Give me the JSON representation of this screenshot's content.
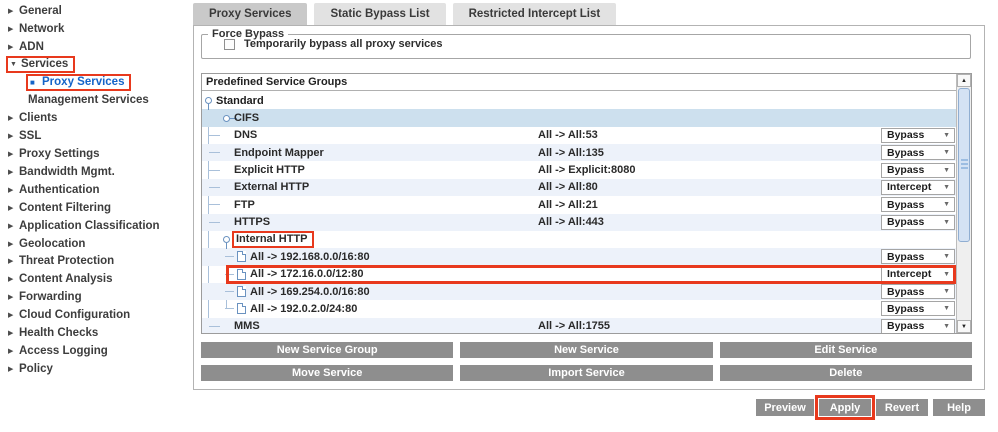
{
  "sidebar": {
    "items": [
      {
        "label": "General",
        "arrow": "right"
      },
      {
        "label": "Network",
        "arrow": "right"
      },
      {
        "label": "ADN",
        "arrow": "right"
      },
      {
        "label": "Services",
        "arrow": "down",
        "highlighted": true
      },
      {
        "label": "Proxy Services",
        "indent": true,
        "bullet": true,
        "selected": true,
        "highlighted": true
      },
      {
        "label": "Management Services",
        "indent": true
      },
      {
        "label": "Clients",
        "arrow": "right"
      },
      {
        "label": "SSL",
        "arrow": "right"
      },
      {
        "label": "Proxy Settings",
        "arrow": "right"
      },
      {
        "label": "Bandwidth Mgmt.",
        "arrow": "right"
      },
      {
        "label": "Authentication",
        "arrow": "right"
      },
      {
        "label": "Content Filtering",
        "arrow": "right"
      },
      {
        "label": "Application Classification",
        "arrow": "right"
      },
      {
        "label": "Geolocation",
        "arrow": "right"
      },
      {
        "label": "Threat Protection",
        "arrow": "right"
      },
      {
        "label": "Content Analysis",
        "arrow": "right"
      },
      {
        "label": "Forwarding",
        "arrow": "right"
      },
      {
        "label": "Cloud Configuration",
        "arrow": "right"
      },
      {
        "label": "Health Checks",
        "arrow": "right"
      },
      {
        "label": "Access Logging",
        "arrow": "right"
      },
      {
        "label": "Policy",
        "arrow": "right"
      }
    ]
  },
  "tabs": [
    {
      "label": "Proxy Services",
      "active": true
    },
    {
      "label": "Static Bypass List",
      "active": false
    },
    {
      "label": "Restricted Intercept List",
      "active": false
    }
  ],
  "force_bypass": {
    "legend": "Force Bypass",
    "checkbox_label": "Temporarily bypass all proxy services",
    "checked": false
  },
  "table": {
    "header": "Predefined Service Groups",
    "rows": [
      {
        "type": "group-open",
        "level": 0,
        "label": "Standard"
      },
      {
        "type": "group-closed",
        "level": 1,
        "label": "CIFS",
        "selected": true
      },
      {
        "type": "service",
        "level": 1,
        "label": "DNS",
        "destination": "All -> All:53",
        "action": "Bypass"
      },
      {
        "type": "service",
        "level": 1,
        "label": "Endpoint Mapper",
        "destination": "All -> All:135",
        "action": "Bypass",
        "shade": true
      },
      {
        "type": "service",
        "level": 1,
        "label": "Explicit HTTP",
        "destination": "All -> Explicit:8080",
        "action": "Bypass"
      },
      {
        "type": "service",
        "level": 1,
        "label": "External HTTP",
        "destination": "All -> All:80",
        "action": "Intercept",
        "shade": true
      },
      {
        "type": "service",
        "level": 1,
        "label": "FTP",
        "destination": "All -> All:21",
        "action": "Bypass"
      },
      {
        "type": "service",
        "level": 1,
        "label": "HTTPS",
        "destination": "All -> All:443",
        "action": "Bypass",
        "shade": true
      },
      {
        "type": "group-open",
        "level": 1,
        "label": "Internal HTTP",
        "highlight": "label"
      },
      {
        "type": "rule",
        "level": 2,
        "label": "All -> 192.168.0.0/16:80",
        "action": "Bypass",
        "shade": true
      },
      {
        "type": "rule",
        "level": 2,
        "label": "All -> 172.16.0.0/12:80",
        "action": "Intercept",
        "highlight": "row"
      },
      {
        "type": "rule",
        "level": 2,
        "label": "All -> 169.254.0.0/16:80",
        "action": "Bypass",
        "shade": true
      },
      {
        "type": "rule",
        "level": 2,
        "label": "All -> 192.0.2.0/24:80",
        "action": "Bypass"
      },
      {
        "type": "service",
        "level": 1,
        "label": "MMS",
        "destination": "All -> All:1755",
        "action": "Bypass",
        "shade": true
      }
    ]
  },
  "action_buttons": {
    "rows": [
      [
        "New Service Group",
        "New Service",
        "Edit Service"
      ],
      [
        "Move Service",
        "Import Service",
        "Delete"
      ]
    ]
  },
  "footer_buttons": [
    {
      "label": "Preview"
    },
    {
      "label": "Apply",
      "highlighted": true
    },
    {
      "label": "Revert"
    },
    {
      "label": "Help"
    }
  ],
  "icons": {
    "chevron_right": "▶",
    "chevron_down": "▼",
    "dropdown_arrow": "▼",
    "scroll_up": "▲",
    "scroll_down": "▼",
    "square_bullet": "■"
  },
  "colors": {
    "highlight_red": "#e8391d",
    "selected_link_blue": "#1464c8",
    "selected_row_blue": "#cde0ee",
    "alt_row_blue": "#edf2fa",
    "button_gray": "#8e8e8e"
  }
}
